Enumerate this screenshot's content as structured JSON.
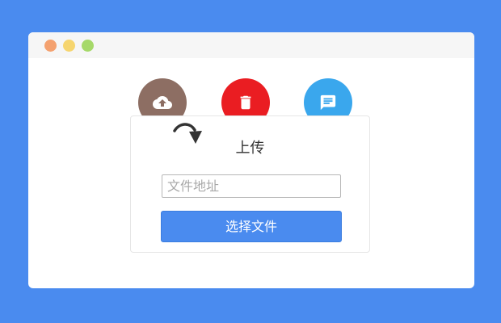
{
  "window": {
    "traffic_lights": [
      "close",
      "minimize",
      "zoom"
    ]
  },
  "actions": [
    {
      "name": "upload",
      "icon": "cloud-upload-icon",
      "color": "#8d6e63"
    },
    {
      "name": "delete",
      "icon": "trash-icon",
      "color": "#ea1d22"
    },
    {
      "name": "comment",
      "icon": "comment-icon",
      "color": "#3aa7ed"
    }
  ],
  "panel": {
    "title": "上传",
    "path_input": {
      "value": "",
      "placeholder": "文件地址"
    },
    "choose_button_label": "选择文件"
  },
  "colors": {
    "background": "#4a8bef",
    "button": "#4a8bef"
  }
}
